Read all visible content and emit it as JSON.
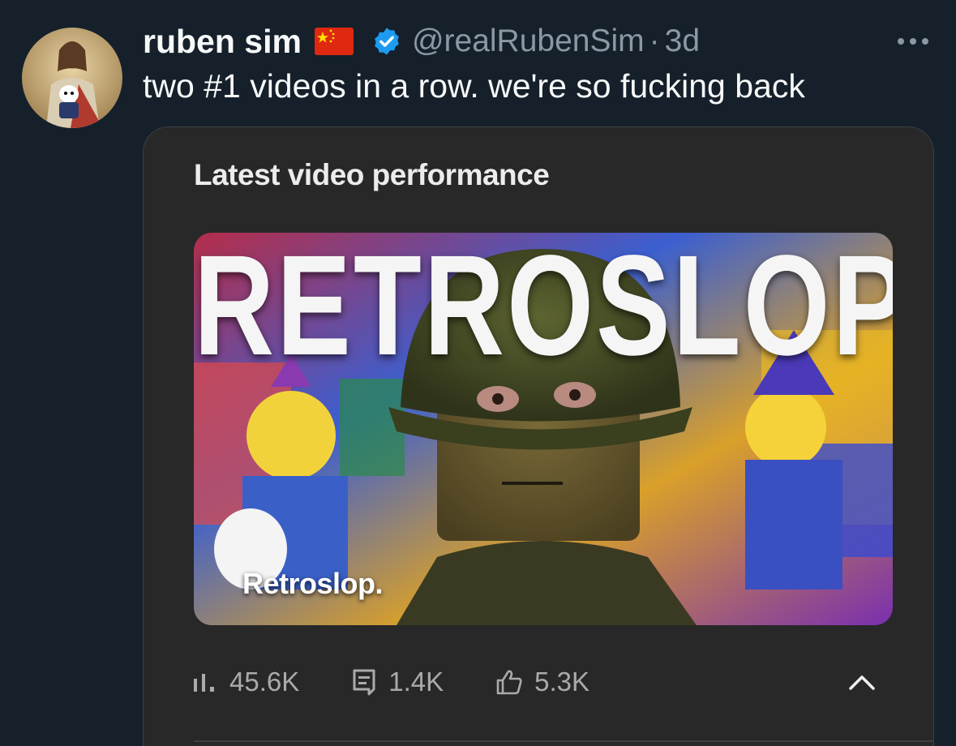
{
  "tweet": {
    "author_name": "ruben sim",
    "flag_icon": "china-flag-icon",
    "verified_icon": "verified-badge-icon",
    "handle": "@realRubenSim",
    "separator": "·",
    "time": "3d",
    "more_icon": "more-options-icon",
    "text": "two #1 videos in a row. we're so fucking back"
  },
  "card": {
    "title": "Latest video performance",
    "thumbnail": {
      "headline": "RETROSLOP",
      "caption": "Retroslop."
    },
    "stats": [
      {
        "icon": "views-bar-icon",
        "value": "45.6K"
      },
      {
        "icon": "comment-icon",
        "value": "1.4K"
      },
      {
        "icon": "like-thumb-icon",
        "value": "5.3K"
      }
    ],
    "collapse_icon": "chevron-up-icon"
  },
  "colors": {
    "background": "#15202b",
    "verified": "#1d9bf0",
    "card_background": "#282828",
    "secondary_text": "#8b98a5"
  }
}
